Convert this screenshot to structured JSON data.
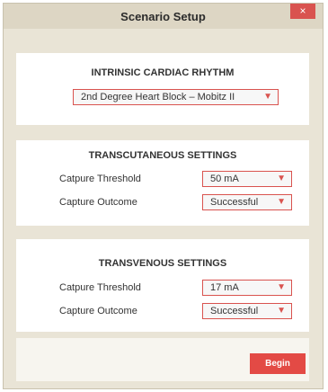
{
  "window": {
    "title": "Scenario Setup",
    "close_label": "×"
  },
  "intrinsic": {
    "heading": "INTRINSIC CARDIAC RHYTHM",
    "rhythm_value": "2nd Degree Heart Block – Mobitz II"
  },
  "transcutaneous": {
    "heading": "TRANSCUTANEOUS SETTINGS",
    "threshold_label": "Catpure Threshold",
    "threshold_value": "50 mA",
    "outcome_label": "Capture Outcome",
    "outcome_value": "Successful"
  },
  "transvenous": {
    "heading": "TRANSVENOUS SETTINGS",
    "threshold_label": "Catpure Threshold",
    "threshold_value": "17 mA",
    "outcome_label": "Capture Outcome",
    "outcome_value": "Successful"
  },
  "footer": {
    "begin_label": "Begin"
  },
  "icons": {
    "chevron": "chevron-down-icon",
    "close": "close-icon"
  },
  "colors": {
    "accent": "#d9534f",
    "background": "#e9e4d6",
    "panel": "#ffffff"
  }
}
